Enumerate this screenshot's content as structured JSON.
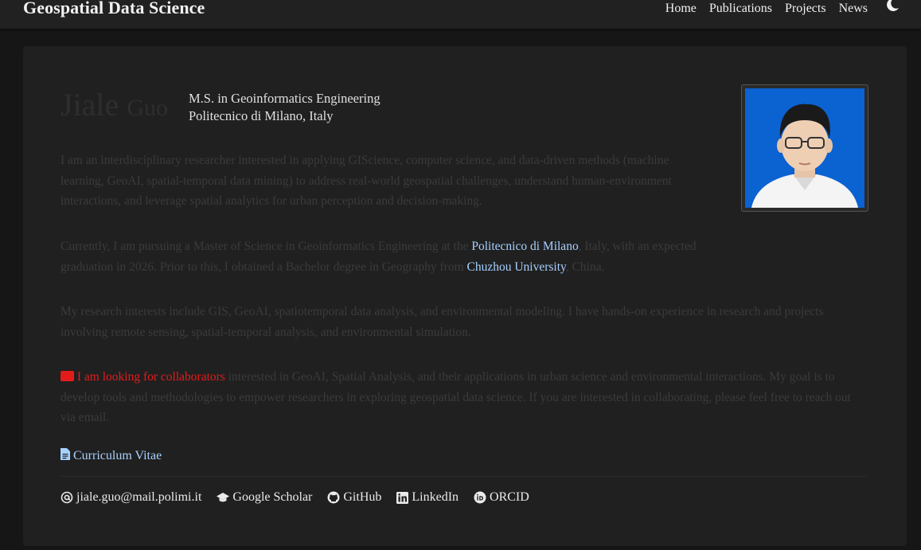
{
  "navbar": {
    "brand": "Geospatial Data Science",
    "links": [
      "Home",
      "Publications",
      "Projects",
      "News"
    ],
    "theme_icon": "moon-icon"
  },
  "profile": {
    "first_name": "Jiale",
    "last_name": "Guo",
    "degree": "M.S. in Geoinformatics Engineering",
    "institution": "Politecnico di Milano, Italy",
    "photo_icon": "profile-photo"
  },
  "bio": {
    "p1": "I am an interdisciplinary researcher interested in applying GIScience, computer science, and data-driven methods (machine learning, GeoAI, spatial-temporal data mining) to address real-world geospatial challenges, understand human-environment interactions, and leverage spatial analytics for urban perception and decision-making.",
    "p2_a": "Currently, I am pursuing a Master of Science in Geoinformatics Engineering at the ",
    "p2_link1": "Politecnico di Milano",
    "p2_b": ", Italy, with an expected graduation in 2026. Prior to this, I obtained a Bachelor degree in Geography from ",
    "p2_link2": "Chuzhou University",
    "p2_c": ", China.",
    "p3": "My research interests include GIS, GeoAI, spatiotemporal data analysis, and environmental modeling. I have hands-on experience in research and projects involving remote sensing, spatial-temporal analysis, and environmental simulation.",
    "p4_link": "I am looking for collaborators",
    "p4_rest": " interested in GeoAI, Spatial Analysis, and their applications in urban science and environmental interactions. My goal is to develop tools and methodologies to empower researchers in exploring geospatial data science. If you are interested in collaborating, please feel free to reach out via email."
  },
  "cv_link": "Curriculum Vitae",
  "contacts": [
    {
      "label": "jiale.guo@mail.polimi.it",
      "icon": "at-icon"
    },
    {
      "label": "Google Scholar",
      "icon": "graduation-cap-icon"
    },
    {
      "label": "GitHub",
      "icon": "github-icon"
    },
    {
      "label": "LinkedIn",
      "icon": "linkedin-icon"
    },
    {
      "label": "ORCID",
      "icon": "orcid-icon"
    }
  ],
  "colors": {
    "background": "#161616",
    "navbar": "#212121",
    "card": "#202020",
    "link": "#a7d1ff",
    "accent_red": "#e41b1b"
  }
}
